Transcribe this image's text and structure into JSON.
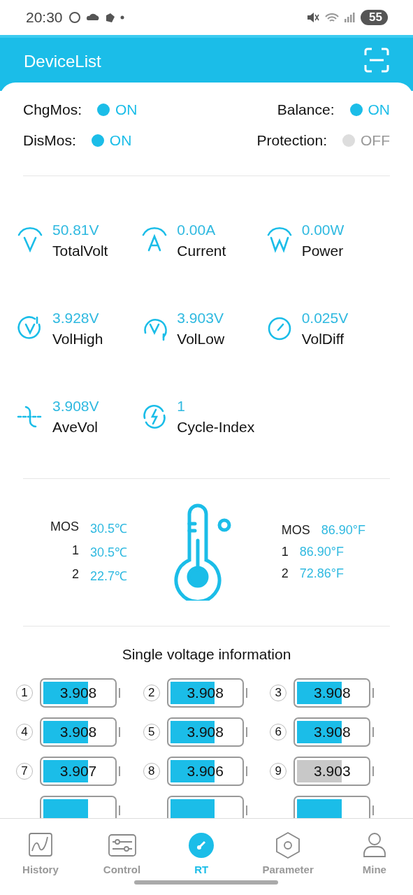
{
  "status_bar": {
    "time": "20:30",
    "battery": "55"
  },
  "header": {
    "title": "DeviceList"
  },
  "switches": [
    {
      "label": "ChgMos:",
      "state": "ON",
      "on": true
    },
    {
      "label": "Balance:",
      "state": "ON",
      "on": true
    },
    {
      "label": "DisMos:",
      "state": "ON",
      "on": true
    },
    {
      "label": "Protection:",
      "state": "OFF",
      "on": false
    }
  ],
  "metrics": [
    {
      "kind": "volt",
      "value": "50.81V",
      "label": "TotalVolt"
    },
    {
      "kind": "amp",
      "value": "0.00A",
      "label": "Current"
    },
    {
      "kind": "watt",
      "value": "0.00W",
      "label": "Power"
    },
    {
      "kind": "high",
      "value": "3.928V",
      "label": "VolHigh"
    },
    {
      "kind": "low",
      "value": "3.903V",
      "label": "VolLow"
    },
    {
      "kind": "diff",
      "value": "0.025V",
      "label": "VolDiff"
    },
    {
      "kind": "avg",
      "value": "3.908V",
      "label": "AveVol"
    },
    {
      "kind": "cycle",
      "value": "1",
      "label": "Cycle-Index"
    }
  ],
  "temps_c": [
    {
      "name": "MOS",
      "value": "30.5℃"
    },
    {
      "name": "1",
      "value": "30.5℃"
    },
    {
      "name": "2",
      "value": "22.7℃"
    }
  ],
  "temps_f": [
    {
      "name": "MOS",
      "value": "86.90°F"
    },
    {
      "name": "1",
      "value": "86.90°F"
    },
    {
      "name": "2",
      "value": "72.86°F"
    }
  ],
  "cells_title": "Single voltage information",
  "cells": [
    {
      "index": "1",
      "value": "3.908",
      "level": 0.6,
      "color": "#1bbde8"
    },
    {
      "index": "2",
      "value": "3.908",
      "level": 0.6,
      "color": "#1bbde8"
    },
    {
      "index": "3",
      "value": "3.908",
      "level": 0.6,
      "color": "#1bbde8"
    },
    {
      "index": "4",
      "value": "3.908",
      "level": 0.6,
      "color": "#1bbde8"
    },
    {
      "index": "5",
      "value": "3.908",
      "level": 0.6,
      "color": "#1bbde8"
    },
    {
      "index": "6",
      "value": "3.908",
      "level": 0.6,
      "color": "#1bbde8"
    },
    {
      "index": "7",
      "value": "3.907",
      "level": 0.6,
      "color": "#1bbde8"
    },
    {
      "index": "8",
      "value": "3.906",
      "level": 0.6,
      "color": "#1bbde8"
    },
    {
      "index": "9",
      "value": "3.903",
      "level": 0.6,
      "color": "#c8c8c8"
    },
    {
      "level": 0.6,
      "color": "#1bbde8"
    },
    {
      "level": 0.6,
      "color": "#1bbde8"
    },
    {
      "level": 0.6,
      "color": "#1bbde8"
    }
  ],
  "tabs": [
    {
      "kind": "history",
      "label": "History",
      "selected": false
    },
    {
      "kind": "control",
      "label": "Control",
      "selected": false
    },
    {
      "kind": "rt",
      "label": "RT",
      "selected": true
    },
    {
      "kind": "parameter",
      "label": "Parameter",
      "selected": false
    },
    {
      "kind": "mine",
      "label": "Mine",
      "selected": false
    }
  ]
}
